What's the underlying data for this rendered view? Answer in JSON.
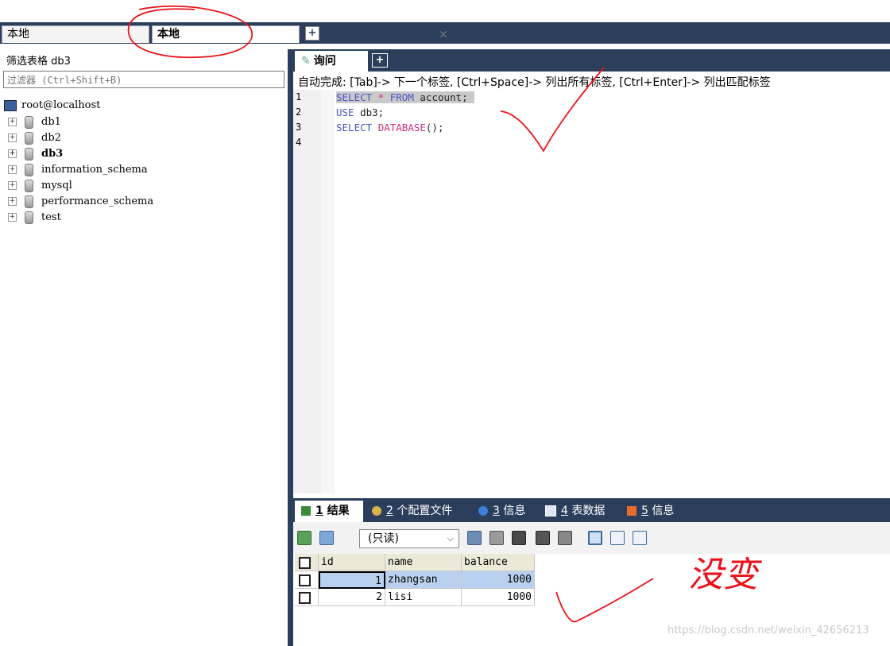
{
  "connection_tabs": [
    {
      "label": "本地"
    },
    {
      "label": "本地",
      "close": "×"
    }
  ],
  "connection_add": "+",
  "filter": {
    "label": "筛选表格 db3",
    "placeholder": "过滤器 (Ctrl+Shift+B)"
  },
  "tree": {
    "root": "root@localhost",
    "databases": [
      {
        "name": "db1",
        "expander": "+"
      },
      {
        "name": "db2",
        "expander": "+"
      },
      {
        "name": "db3",
        "expander": "+"
      },
      {
        "name": "information_schema",
        "expander": "+"
      },
      {
        "name": "mysql",
        "expander": "+"
      },
      {
        "name": "performance_schema",
        "expander": "+"
      },
      {
        "name": "test",
        "expander": "+"
      }
    ]
  },
  "query_tab": {
    "label": "询问",
    "add": "+"
  },
  "autocomplete_hint": "自动完成: [Tab]-> 下一个标签, [Ctrl+Space]-> 列出所有标签, [Ctrl+Enter]-> 列出匹配标签",
  "editor": {
    "line_numbers": [
      "1",
      "2",
      "3",
      "4"
    ],
    "line1": {
      "kw1": "SELECT",
      "star": "*",
      "kw2": "FROM",
      "rest": "account;"
    },
    "line2": {
      "kw": "USE",
      "rest": "db3;"
    },
    "line3": {
      "kw": "SELECT",
      "fn": "DATABASE",
      "rest": "();"
    }
  },
  "result_tabs": [
    {
      "num": "1",
      "label": "结果"
    },
    {
      "num": "2",
      "label": "个配置文件"
    },
    {
      "num": "3",
      "label": "信息"
    },
    {
      "num": "4",
      "label": "表数据"
    },
    {
      "num": "5",
      "label": "信息"
    }
  ],
  "result_toolbar": {
    "mode": "(只读)",
    "mode_arrow": "⌵"
  },
  "grid": {
    "columns": [
      "id",
      "name",
      "balance"
    ],
    "rows": [
      {
        "id": "1",
        "name": "zhangsan",
        "balance": "1000"
      },
      {
        "id": "2",
        "name": "lisi",
        "balance": "1000"
      }
    ]
  },
  "handwritten_note": "没变",
  "watermark": "https://blog.csdn.net/weixin_42656213",
  "colors": {
    "frame": "#2b3f5c",
    "annotation": "#e8131a",
    "keyword": "#4a55c4",
    "function": "#cc2f7a",
    "selected_cell": "#b9d1ee"
  }
}
